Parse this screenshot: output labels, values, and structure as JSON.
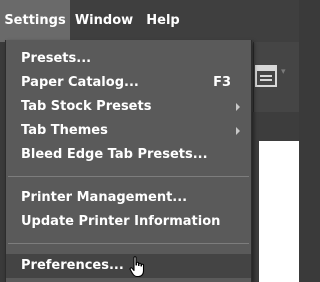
{
  "menubar": {
    "items": [
      {
        "label": "Settings"
      },
      {
        "label": "Window"
      },
      {
        "label": "Help"
      }
    ]
  },
  "settings_menu": {
    "items": [
      {
        "label": "Presets...",
        "shortcut": ""
      },
      {
        "label": "Paper Catalog...",
        "shortcut": "F3"
      },
      {
        "label": "Tab Stock Presets",
        "submenu": true
      },
      {
        "label": "Tab Themes",
        "submenu": true
      },
      {
        "label": "Bleed Edge Tab Presets..."
      },
      {
        "label": "Printer Management..."
      },
      {
        "label": "Update Printer Information"
      },
      {
        "label": "Preferences...",
        "hovered": true
      }
    ]
  },
  "colors": {
    "menu_bg": "#5a5a5a",
    "menubar_bg": "#3f3f3f",
    "active_menubar_item": "#6a6a6a",
    "hover_item": "#444444",
    "text": "#ffffff"
  }
}
